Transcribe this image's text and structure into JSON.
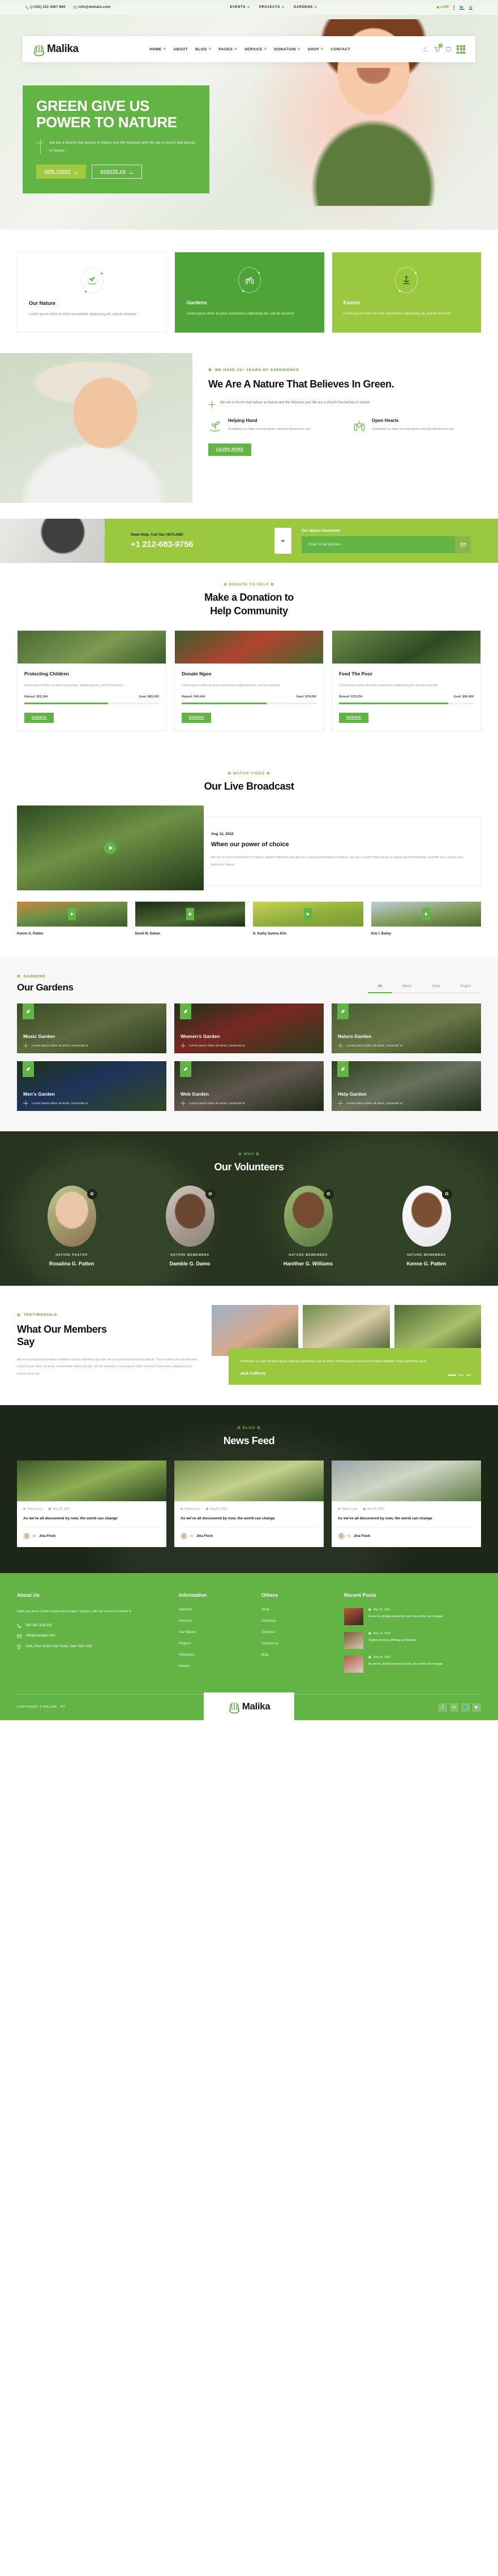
{
  "topbar": {
    "phone": "(+123) 123 4567 890",
    "email": "info@domain.com",
    "links": [
      "EVENTS",
      "PROJECTS",
      "GARDENS"
    ],
    "live_label": "LIVE",
    "socials": [
      "facebook-icon",
      "twitter-icon",
      "instagram-icon"
    ]
  },
  "brand": {
    "name": "Malika"
  },
  "nav": {
    "items": [
      "HOME",
      "ABOUT",
      "BLOG",
      "PAGES",
      "SERVICE",
      "DONATION",
      "SHOP",
      "CONTACT"
    ],
    "cart_count": "0"
  },
  "hero": {
    "title_line1": "GREEN GIVE US",
    "title_line2": "POWER TO NATURE",
    "desc": "We are a church that belives in Nature and the followers and We are a church that belives in Nature.",
    "btn_primary": "JOIN TODAY",
    "btn_secondary": "DONATE US"
  },
  "features": [
    {
      "title": "Our Nature",
      "desc": "Lorem ipsum dolor sit amet consectetur adipisicing elit, sed do eiusmod",
      "icon": "plant-in-hand-icon"
    },
    {
      "title": "Gardens",
      "desc": "Lorem ipsum dolor sit amet consectetur adipisicing elit, sed do eiusmod",
      "icon": "hands-plant-icon"
    },
    {
      "title": "Events",
      "desc": "Lorem ipsum dolor sit amet consectetur adipisicing elit, sed do eiusmod",
      "icon": "sprout-sun-icon"
    }
  ],
  "about": {
    "eyebrow": "WE HAVE 25+ YEARS OF EXPERIENCE",
    "title": "We Are A Nature That Believes In Green.",
    "lead": "We are a church that belives in Nature and the followers and We are a church that belives in Nature",
    "cols": [
      {
        "title": "Helping Hand",
        "desc": "Vestibulum ac diam sit amet quam vehicula elementum sed."
      },
      {
        "title": "Open Hearts",
        "desc": "Vestibulum ac diam sit amet quam vehicula elementum sed."
      }
    ],
    "cta": "LEARN MORE"
  },
  "hotline": {
    "label": "Need Help, Call Our HOTLINE!",
    "number": "+1 212-683-9756",
    "or": "or",
    "newsletter_label": "Our Nature Newsletter",
    "placeholder": "Enter email address"
  },
  "donation": {
    "eyebrow": "DONATE TO HELP",
    "title_line1": "Make a Donation to",
    "title_line2": "Help Community",
    "button": "DONATE",
    "cards": [
      {
        "title": "Protecting Children",
        "desc": "Lorem ipsum dolor sit amet consectetur adipisicing elit, sed do eiusmod",
        "raised": "Raised: $52,384",
        "goal": "Goal: $85,000",
        "pct": 62
      },
      {
        "title": "Donate Ngos",
        "desc": "Lorem ipsum dolor sit amet consectetur adipisicing elit, sed do eiusmod",
        "raised": "Raised: $49,444",
        "goal": "Goal: $78,000",
        "pct": 63
      },
      {
        "title": "Feed The Poor",
        "desc": "Lorem ipsum dolor sit amet consectetur adipisicing elit, sed do eiusmod",
        "raised": "Raised: $78,334",
        "goal": "Goal: $96,400",
        "pct": 81
      }
    ]
  },
  "broadcast": {
    "eyebrow": "WATCH VIDEO",
    "title": "Our Live Broadcast",
    "date": "Aug 12, 2022",
    "headline": "When our power of choice",
    "desc": "We are a church that belives in Nature and the followers and We are a church that belives in Nature. We are a church that belives in Nature and the followers and We are a church that belives in Nature.",
    "thumbs": [
      {
        "name": "Kenne G. Patten"
      },
      {
        "name": "David M. Dahan"
      },
      {
        "name": "D. Kathy Santos Kito"
      },
      {
        "name": "Kim I. Bailey"
      }
    ]
  },
  "gardens": {
    "eyebrow": "GARDENS",
    "title": "Our Gardens",
    "tabs": [
      "All",
      "Music",
      "Choir",
      "Project"
    ],
    "active_tab": "All",
    "cards": [
      {
        "title": "Music Garden",
        "desc": "Lorem ipsum dolor sit amet, consectet ur"
      },
      {
        "title": "Women's Garden",
        "desc": "Lorem ipsum dolor sit amet, consectet ur"
      },
      {
        "title": "Nature Garden",
        "desc": "Lorem ipsum dolor sit amet, consectet ur"
      },
      {
        "title": "Men's Garden",
        "desc": "Lorem ipsum dolor sit amet, consectet ur"
      },
      {
        "title": "Web Garden",
        "desc": "Lorem ipsum dolor sit amet, consectet ur"
      },
      {
        "title": "Help Garden",
        "desc": "Lorem ipsum dolor sit amet, consectet ur"
      }
    ]
  },
  "volunteers": {
    "eyebrow": "WHO",
    "title": "Our Volunteers",
    "people": [
      {
        "role": "NATURE PASTOR",
        "name": "Rosalina G. Patten"
      },
      {
        "role": "NATURE MEMEMBER",
        "name": "Damble G. Damo"
      },
      {
        "role": "NATURE MEMEMBER",
        "name": "Hanither G. Williams"
      },
      {
        "role": "NATURE MEMEMBER",
        "name": "Kenne G. Patten"
      }
    ]
  },
  "testimonials": {
    "eyebrow": "TESTIMONIALS",
    "title_line1": "What Our Members",
    "title_line2": "Say",
    "desc": "We are a church that belives in Nature and the followers and We are a church that belives in Nature. This is where you should start Lorem ipsum dolor sit amet, consectetur adipiscing elit, sed do eiusmod. Lorem ipsum dolor sit amet consectetur adipiscing elit, sed do eiusmod.",
    "quote": "Vestibulum ac diam sit amet quam vehicula elementum sed sit amet. Pellentesque in ipsum id orci porta dapibus. Proin eget tortor risus.",
    "author": "Jack Anthony"
  },
  "blog": {
    "eyebrow": "BLOG",
    "title": "News Feed",
    "posts": [
      {
        "meta_date": "May 20, 2022",
        "meta_cat": "Nature Love",
        "headline": "As we've all discovered by now, the world can change",
        "by": "By",
        "author": "Jina Flock"
      },
      {
        "meta_date": "May 20, 2022",
        "meta_cat": "Nature Love",
        "headline": "As we've all discovered by now, the world can change",
        "by": "By",
        "author": "Jina Flock"
      },
      {
        "meta_date": "May 20, 2022",
        "meta_cat": "Nature Love",
        "headline": "As we've all discovered by now, the world can change",
        "by": "By",
        "author": "Jina Flock"
      }
    ]
  },
  "footer": {
    "about_title": "About Us",
    "about_text": "Nulla quis lorem ut libero malesuada feugiat. Quisque velit nisi, pretium ut lacinia in",
    "phone": "987-987-930-302",
    "email": "info@example.com",
    "address": "14/A, Poor Street City Tower, New York USA",
    "info_title": "Information",
    "info_links": [
      "Gardens",
      "Services",
      "Our Nature",
      "Projects",
      "Volunteers",
      "Events"
    ],
    "others_title": "Others",
    "others_links": [
      "Shop",
      "Checkout",
      "Donation",
      "Contact Us",
      "Blog"
    ],
    "recent_title": "Recent Posts",
    "recent_posts": [
      {
        "date": "May 20, 2022",
        "text": "As we've all discovered by now, the world can change"
      },
      {
        "date": "May 20, 2022",
        "text": "Testimony love offering so blessed"
      },
      {
        "date": "May 20, 2022",
        "text": "As we've all discovered by now, the world can change"
      }
    ],
    "copyright": "COPYRIGHT © MALIKA - BY",
    "socials": [
      "facebook-icon",
      "linkedin-icon",
      "twitter-icon",
      "youtube-icon"
    ]
  },
  "colors": {
    "green": "#62b544",
    "lime": "#9ac93f",
    "dark": "#1d2717",
    "deep": "#27341f"
  }
}
